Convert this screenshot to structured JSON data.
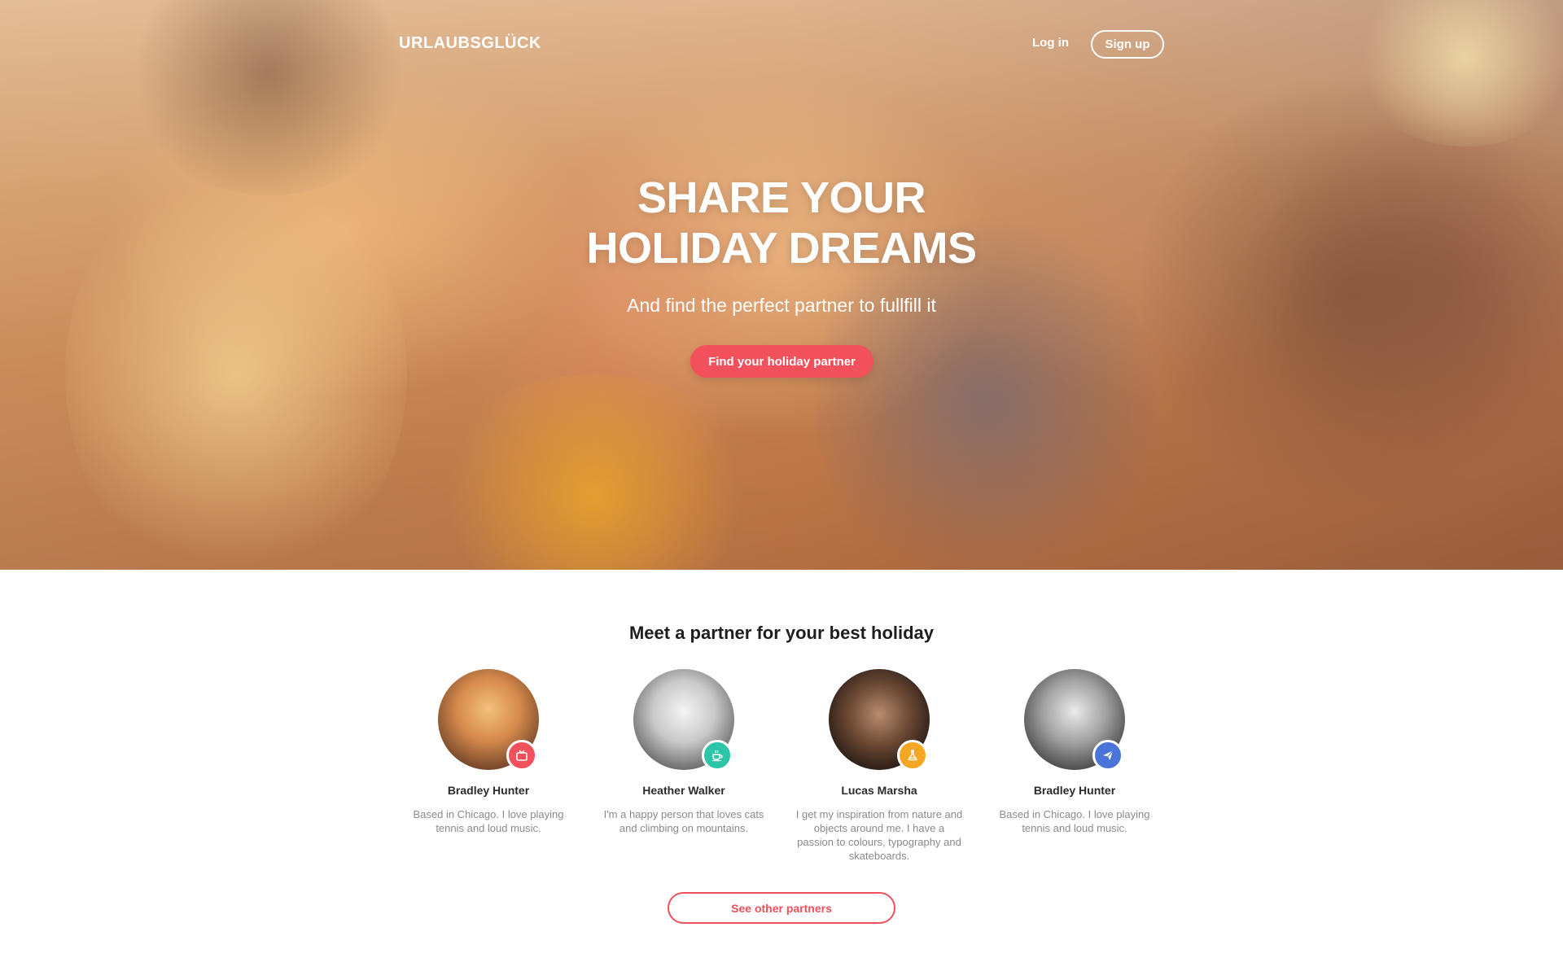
{
  "nav": {
    "logo": "URLAUBSGLÜCK",
    "login": "Log in",
    "signup": "Sign up"
  },
  "hero": {
    "title_line1": "SHARE YOUR",
    "title_line2": "HOLIDAY DREAMS",
    "subtitle": "And find the perfect partner to fullfill it",
    "cta": "Find your holiday partner"
  },
  "partners": {
    "title": "Meet a partner for your best holiday",
    "items": [
      {
        "name": "Bradley Hunter",
        "desc": "Based in Chicago. I love playing tennis and loud music.",
        "badge_icon": "tv-icon",
        "badge_color": "#f2505a"
      },
      {
        "name": "Heather Walker",
        "desc": "I'm a happy person that loves cats and climbing on mountains.",
        "badge_icon": "coffee-icon",
        "badge_color": "#2cc5a8"
      },
      {
        "name": "Lucas Marsha",
        "desc": "I get my inspiration from nature and objects around me. I have a passion to colours, typography and skateboards.",
        "badge_icon": "flask-icon",
        "badge_color": "#f5a623"
      },
      {
        "name": "Bradley Hunter",
        "desc": "Based in Chicago. I love playing tennis and loud music.",
        "badge_icon": "send-icon",
        "badge_color": "#4a74d9"
      }
    ],
    "more": "See other partners"
  },
  "colors": {
    "accent": "#f2505a",
    "teal": "#2cc5a8",
    "orange": "#f5a623",
    "blue": "#4a74d9"
  }
}
